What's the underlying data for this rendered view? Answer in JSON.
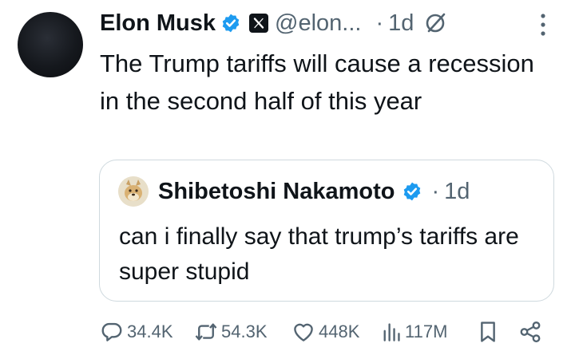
{
  "author": {
    "name": "Elon Musk",
    "handle": "@elon...",
    "time": "1d",
    "separator": "·"
  },
  "tweet": {
    "text": "The Trump tariffs will cause a recession in the second half of this year"
  },
  "quoted": {
    "name": "Shibetoshi Nakamoto",
    "separator": "·",
    "time": "1d",
    "text": "can i finally say that trump’s tariffs are super stupid"
  },
  "actions": {
    "replies": "34.4K",
    "reposts": "54.3K",
    "likes": "448K",
    "views": "117M"
  },
  "colors": {
    "verified": "#1d9bf0",
    "muted": "#536471",
    "text": "#0f1419",
    "border": "#cfd9de"
  },
  "icons": [
    "verified-badge-icon",
    "x-logo-icon",
    "grok-icon",
    "more-icon",
    "reply-icon",
    "repost-icon",
    "like-icon",
    "views-icon",
    "bookmark-icon",
    "share-icon"
  ]
}
